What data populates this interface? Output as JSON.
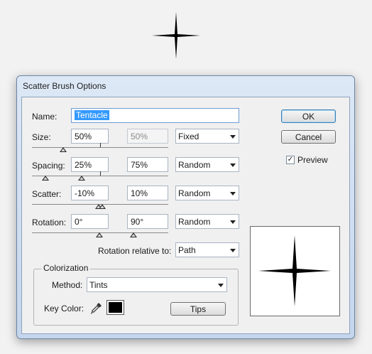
{
  "dialog": {
    "title": "Scatter Brush Options",
    "name_label": "Name:",
    "name_value": "Tentacle",
    "ok_label": "OK",
    "cancel_label": "Cancel",
    "preview_label": "Preview",
    "preview_checked": true,
    "preview_checkmark": "✓"
  },
  "rows": {
    "size": {
      "label": "Size:",
      "min": "50%",
      "max": "50%",
      "mode": "Fixed"
    },
    "spacing": {
      "label": "Spacing:",
      "min": "25%",
      "max": "75%",
      "mode": "Random"
    },
    "scatter": {
      "label": "Scatter:",
      "min": "-10%",
      "max": "10%",
      "mode": "Random"
    },
    "rotation": {
      "label": "Rotation:",
      "min": "0°",
      "max": "90°",
      "mode": "Random"
    }
  },
  "rotation_relative": {
    "label": "Rotation relative to:",
    "value": "Path"
  },
  "colorization": {
    "group_label": "Colorization",
    "method_label": "Method:",
    "method_value": "Tints",
    "key_color_label": "Key Color:",
    "key_color": "#000000",
    "tips_label": "Tips"
  },
  "colors": {
    "accent": "#3399ff",
    "title_gradient": "#c5d6ec",
    "brush_fill": "#000000"
  }
}
